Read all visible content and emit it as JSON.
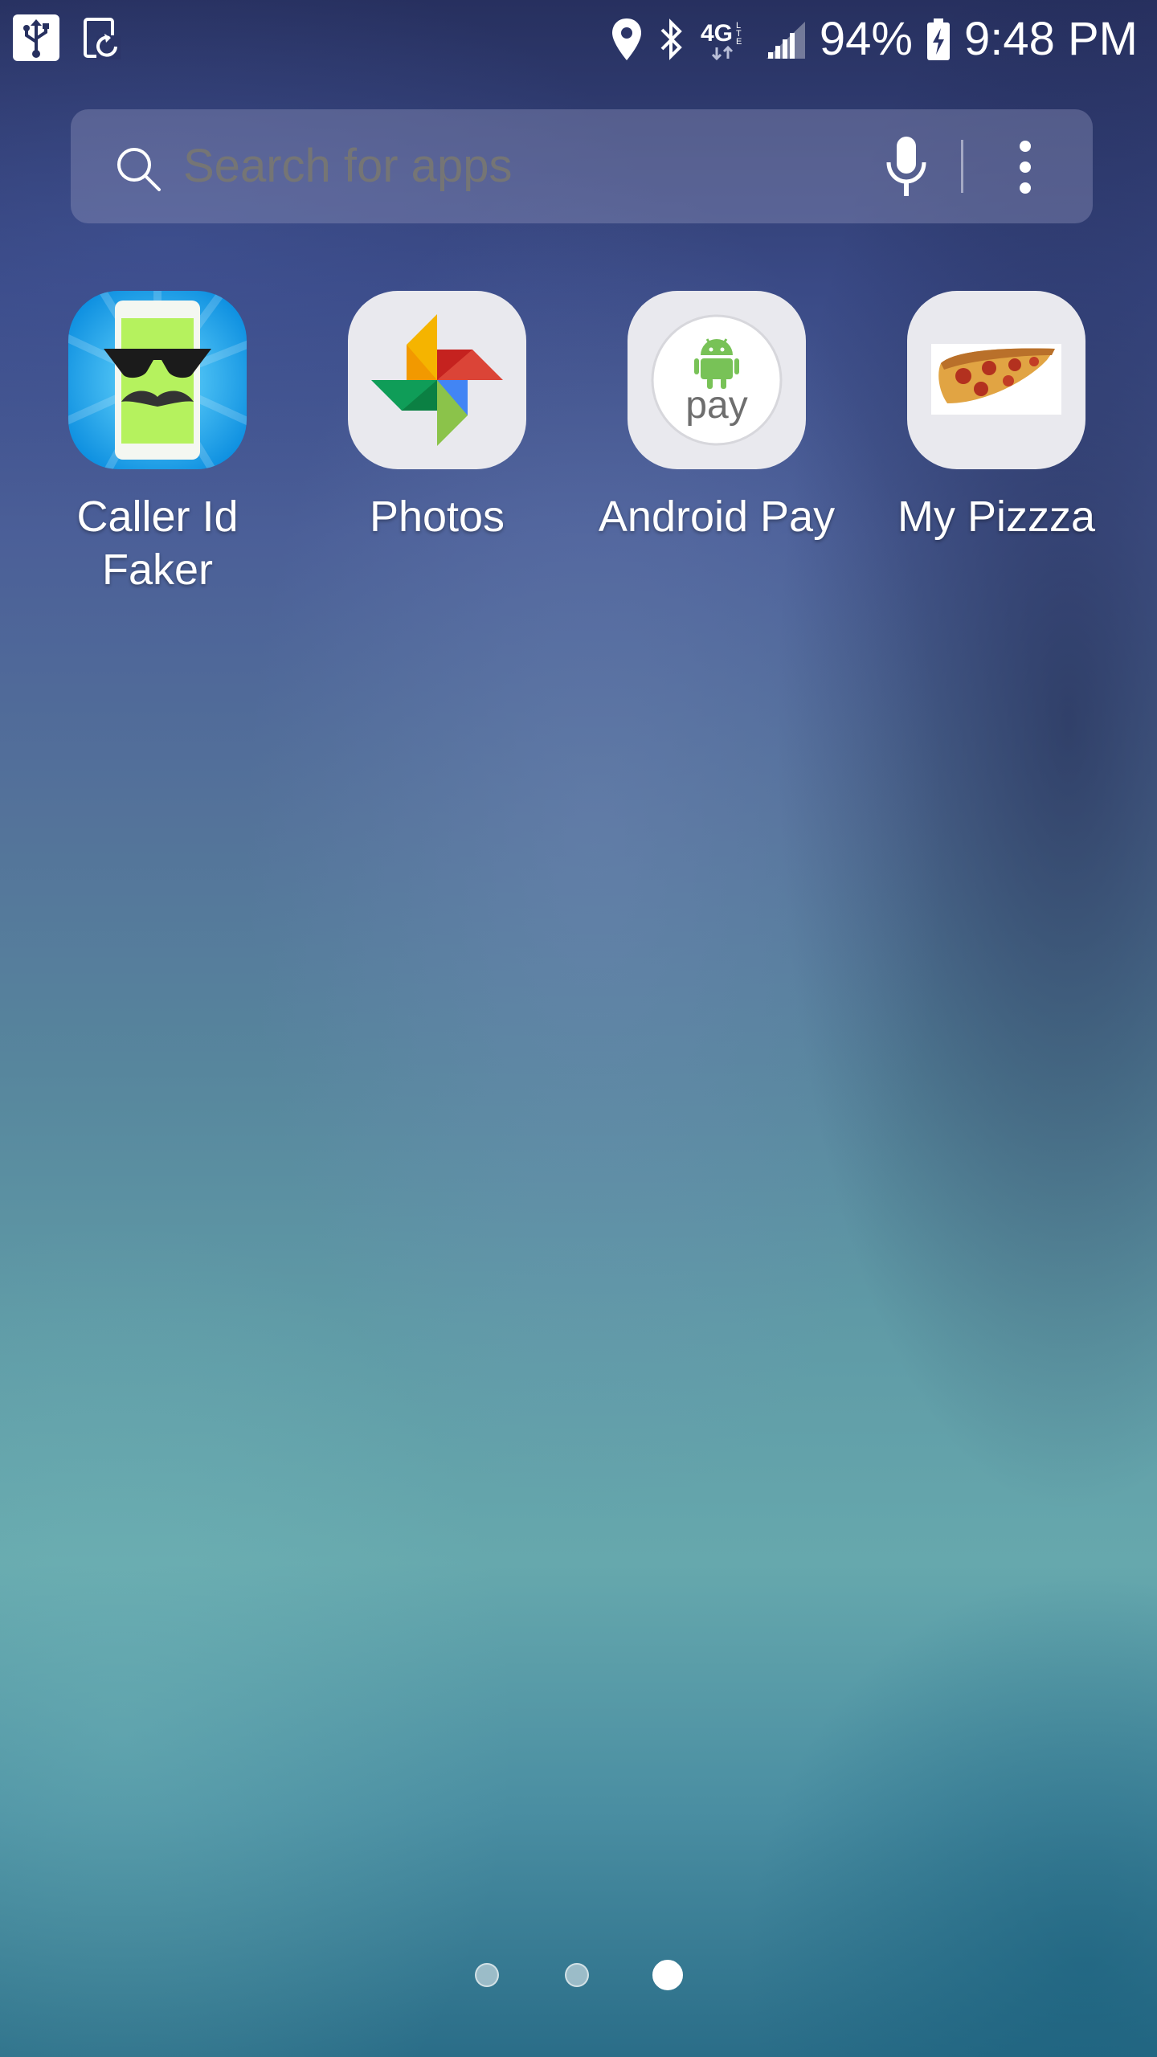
{
  "status_bar": {
    "left_icons": [
      "usb-icon",
      "screen-rotation-icon"
    ],
    "right_icons": [
      "location-icon",
      "bluetooth-icon",
      "4g-lte-icon",
      "signal-icon",
      "battery-charging-icon"
    ],
    "network": "4G LTE",
    "battery": "94%",
    "time": "9:48 PM"
  },
  "search": {
    "placeholder": "Search for apps",
    "icon": "search-icon",
    "voice_icon": "mic-icon",
    "menu_icon": "more-vert-icon"
  },
  "apps": [
    {
      "label": "Caller Id Faker",
      "icon": "caller-id-faker-icon"
    },
    {
      "label": "Photos",
      "icon": "photos-pinwheel-icon"
    },
    {
      "label": "Android Pay",
      "icon": "android-pay-icon"
    },
    {
      "label": "My Pizzza",
      "icon": "pizza-slice-icon"
    }
  ],
  "android_pay_icon_text": "pay",
  "page_indicator": {
    "pages": 3,
    "current": 3
  },
  "colors": {
    "wallpaper_top": "#27305f",
    "wallpaper_bottom": "#2a6d88",
    "search_bar_bg": "#8c91b9",
    "text": "#ffffff"
  }
}
